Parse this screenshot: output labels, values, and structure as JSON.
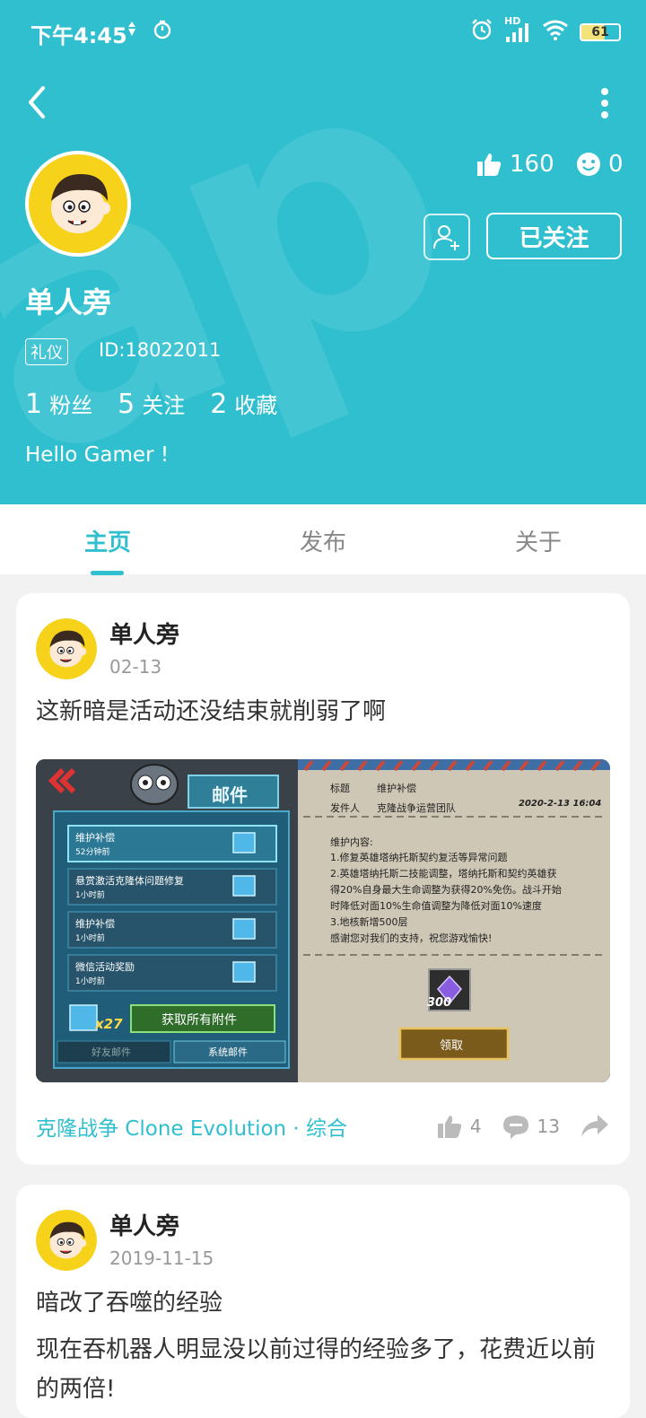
{
  "status_bar": {
    "time": "下午4:45",
    "signal_label": "HD",
    "battery_level": "61"
  },
  "profile": {
    "name": "单人旁",
    "badge": "礼仪",
    "id": "ID:18022011",
    "likes": "160",
    "smiles": "0",
    "follow_button": "已关注",
    "fans_count": "1",
    "fans_label": "粉丝",
    "following_count": "5",
    "following_label": "关注",
    "favorites_count": "2",
    "favorites_label": "收藏",
    "bio": "Hello Gamer !"
  },
  "tabs": [
    {
      "label": "主页",
      "active": true
    },
    {
      "label": "发布",
      "active": false
    },
    {
      "label": "关于",
      "active": false
    }
  ],
  "posts": [
    {
      "author": "单人旁",
      "date": "02-13",
      "text": "这新暗是活动还没结束就削弱了啊",
      "forum": "克隆战争 Clone Evolution · 综合",
      "likes": "4",
      "comments": "13",
      "image": {
        "mail_title": "邮件",
        "mails": [
          {
            "title": "维护补偿",
            "time": "52分钟前"
          },
          {
            "title": "悬赏激活克隆体问题修复",
            "time": "1小时前"
          },
          {
            "title": "维护补偿",
            "time": "1小时前"
          },
          {
            "title": "微信活动奖励",
            "time": "1小时前"
          }
        ],
        "item_count": "x27",
        "claim_all": "获取所有附件",
        "tab_friends": "好友邮件",
        "tab_system": "系统邮件",
        "label_title": "标题",
        "value_title": "维护补偿",
        "label_sender": "发件人",
        "value_sender": "克隆战争运营团队",
        "date": "2020-2-13 16:04",
        "content_header": "维护内容:",
        "content_lines": [
          "1.修复英雄塔纳托斯契约复活等异常问题",
          "2.英雄塔纳托斯二技能调整，塔纳托斯和契约英雄获",
          "得20%自身最大生命调整为获得20%免伤。战斗开始",
          "时降低对面10%生命值调整为降低对面10%速度",
          "3.地核新增500层",
          "感谢您对我们的支持，祝您游戏愉快!"
        ],
        "reward_amount": "300",
        "claim": "领取"
      }
    },
    {
      "author": "单人旁",
      "date": "2019-11-15",
      "title": "暗改了吞噬的经验",
      "text": "现在吞机器人明显没以前过得的经验多了，花费近以前的两倍!"
    }
  ],
  "colors": {
    "accent": "#2fbfcf",
    "avatar_yellow": "#f7d21b"
  }
}
